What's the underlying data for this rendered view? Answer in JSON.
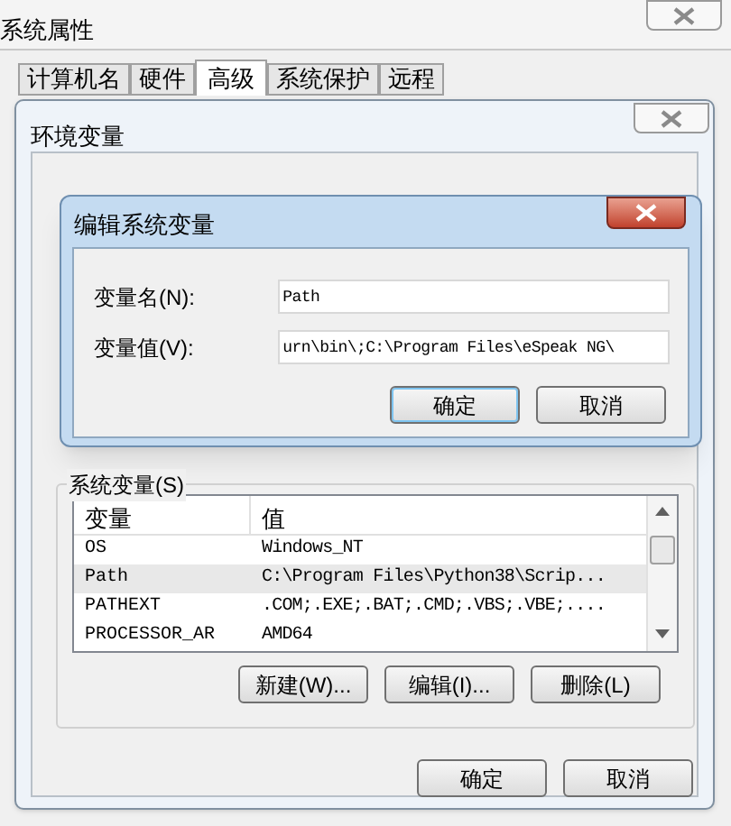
{
  "window": {
    "title": "系统属性"
  },
  "tabs": [
    {
      "label": "计算机名",
      "selected": false
    },
    {
      "label": "硬件",
      "selected": false
    },
    {
      "label": "高级",
      "selected": true
    },
    {
      "label": "系统保护",
      "selected": false
    },
    {
      "label": "远程",
      "selected": false
    }
  ],
  "env_window": {
    "title": "环境变量",
    "system_vars": {
      "label": "系统变量(S)",
      "columns": [
        "变量",
        "值"
      ],
      "rows": [
        {
          "name": "OS",
          "value": "Windows_NT",
          "selected": false
        },
        {
          "name": "Path",
          "value": "C:\\Program Files\\Python38\\Scrip...",
          "selected": true
        },
        {
          "name": "PATHEXT",
          "value": ".COM;.EXE;.BAT;.CMD;.VBS;.VBE;....",
          "selected": false
        },
        {
          "name": "PROCESSOR_AR",
          "value": "AMD64",
          "selected": false
        }
      ],
      "buttons": [
        "新建(W)...",
        "编辑(I)...",
        "删除(L)"
      ]
    },
    "buttons": [
      "确定",
      "取消"
    ]
  },
  "edit_dialog": {
    "title": "编辑系统变量",
    "name_label": "变量名(N):",
    "name_value": "Path",
    "value_label": "变量值(V):",
    "value_value": "urn\\bin\\;C:\\Program Files\\eSpeak NG\\",
    "buttons": [
      "确定",
      "取消"
    ]
  }
}
